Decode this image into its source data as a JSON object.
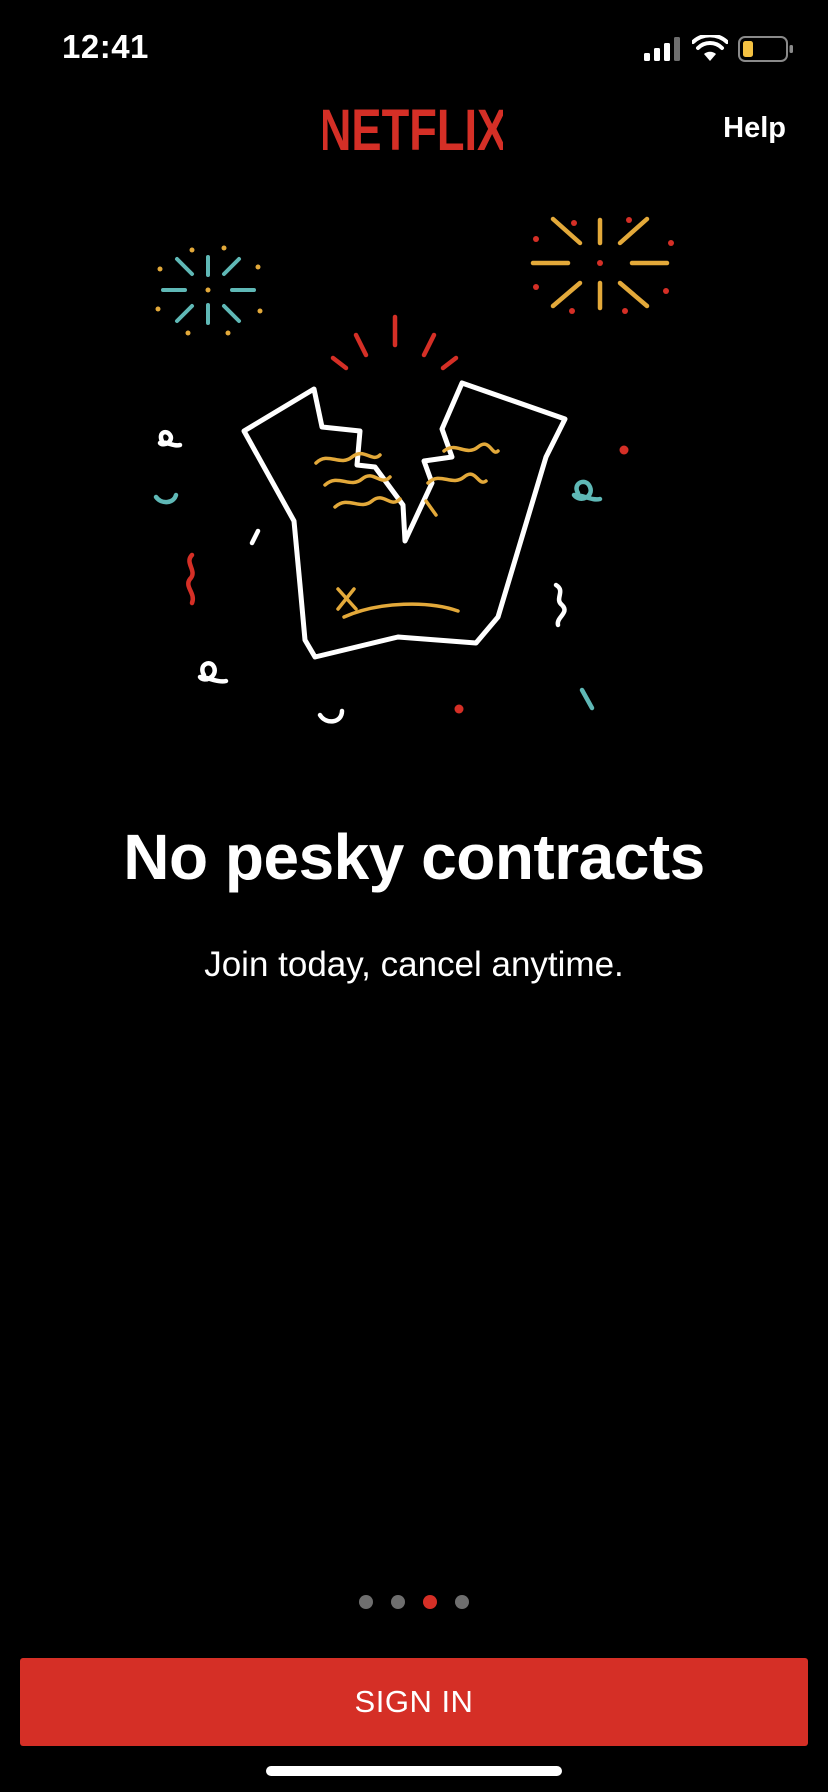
{
  "status_bar": {
    "time": "12:41",
    "icons": [
      "signal-icon",
      "wifi-icon",
      "battery-icon"
    ]
  },
  "header": {
    "logo_text": "NETFLIX",
    "help_label": "Help"
  },
  "onboarding": {
    "headline": "No pesky contracts",
    "subline": "Join today, cancel anytime.",
    "pages_total": 4,
    "active_page": 3
  },
  "actions": {
    "sign_in_label": "SIGN IN"
  },
  "colors": {
    "brand_red": "#d52f26",
    "background": "#000000",
    "text": "#ffffff",
    "dot_inactive": "#6e6e6e",
    "confetti_gold": "#e3a93a",
    "confetti_teal": "#5fb8b6",
    "battery_yellow": "#f5c242"
  }
}
